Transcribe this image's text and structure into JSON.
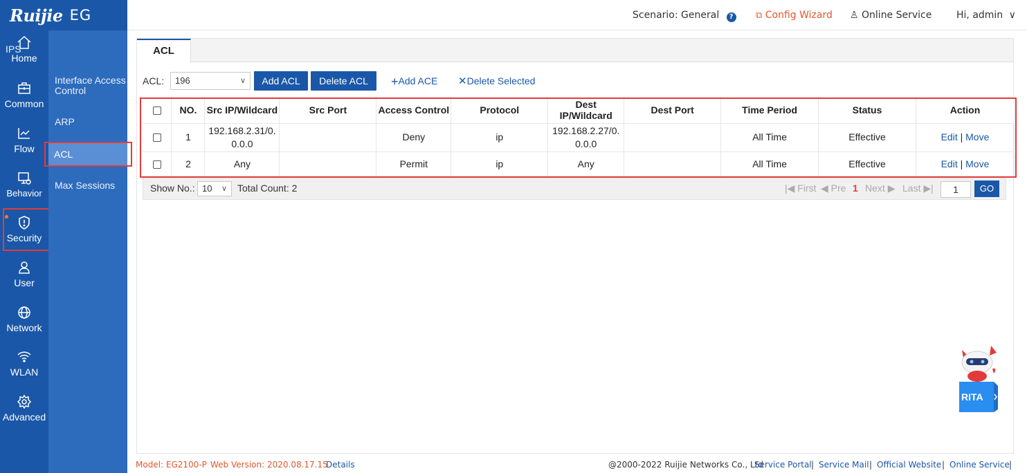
{
  "brand": {
    "logo": "Ruijie",
    "product": "EG"
  },
  "nav": [
    {
      "label": "Home",
      "icon": "home-icon"
    },
    {
      "label": "Common",
      "icon": "briefcase-icon"
    },
    {
      "label": "Flow",
      "icon": "chart-icon"
    },
    {
      "label": "Behavior",
      "icon": "monitor-icon"
    },
    {
      "label": "Security",
      "icon": "shield-icon"
    },
    {
      "label": "User",
      "icon": "user-icon"
    },
    {
      "label": "Network",
      "icon": "globe-icon"
    },
    {
      "label": "WLAN",
      "icon": "wifi-icon"
    },
    {
      "label": "Advanced",
      "icon": "gear-icon"
    }
  ],
  "subnav": [
    {
      "label": "IPS"
    },
    {
      "label": "Interface Access Control"
    },
    {
      "label": "ARP"
    },
    {
      "label": "ACL"
    },
    {
      "label": "Max Sessions"
    }
  ],
  "topbar": {
    "scenario_label": "Scenario:",
    "scenario_value": "General",
    "config_wizard": "Config Wizard",
    "online_service": "Online Service",
    "greeting": "Hi, admin"
  },
  "tab": {
    "label": "ACL"
  },
  "toolbar": {
    "acl_label": "ACL:",
    "acl_value": "196",
    "add_acl": "Add ACL",
    "delete_acl": "Delete ACL",
    "add_ace": "Add ACE",
    "delete_selected": "Delete Selected"
  },
  "table": {
    "headers": [
      "NO.",
      "Src IP/Wildcard",
      "Src Port",
      "Access Control",
      "Protocol",
      "Dest IP/Wildcard",
      "Dest Port",
      "Time Period",
      "Status",
      "Action"
    ],
    "rows": [
      {
        "no": "1",
        "src_ip": "192.168.2.31/0.0.0.0",
        "src_port": "",
        "access": "Deny",
        "protocol": "ip",
        "dest_ip": "192.168.2.27/0.0.0.0",
        "dest_port": "",
        "time": "All Time",
        "status": "Effective",
        "edit": "Edit",
        "sep": "|",
        "move": "Move"
      },
      {
        "no": "2",
        "src_ip": "Any",
        "src_port": "",
        "access": "Permit",
        "protocol": "ip",
        "dest_ip": "Any",
        "dest_port": "",
        "time": "All Time",
        "status": "Effective",
        "edit": "Edit",
        "sep": "|",
        "move": "Move"
      }
    ]
  },
  "pager": {
    "show_no_label": "Show No.:",
    "show_no_value": "10",
    "total_count": "Total Count: 2",
    "first": "First",
    "prev": "Pre",
    "current": "1",
    "next": "Next",
    "last": "Last",
    "goto_value": "1",
    "go": "GO"
  },
  "footer": {
    "model": "Model: EG2100-P",
    "version": "Web Version: 2020.08.17.15",
    "details": "Details",
    "copyright": "@2000-2022 Ruijie Networks Co., Ltd",
    "links": [
      "Service Portal",
      "Service Mail",
      "Official Website",
      "Online Service"
    ],
    "sep": "|"
  },
  "assistant": {
    "label": "RITA"
  },
  "colors": {
    "nav_bg": "#1a57a8",
    "subnav_bg": "#2d6bbd",
    "accent": "#1a57a8",
    "highlight": "#e23b3b",
    "wizard": "#e2572b"
  }
}
